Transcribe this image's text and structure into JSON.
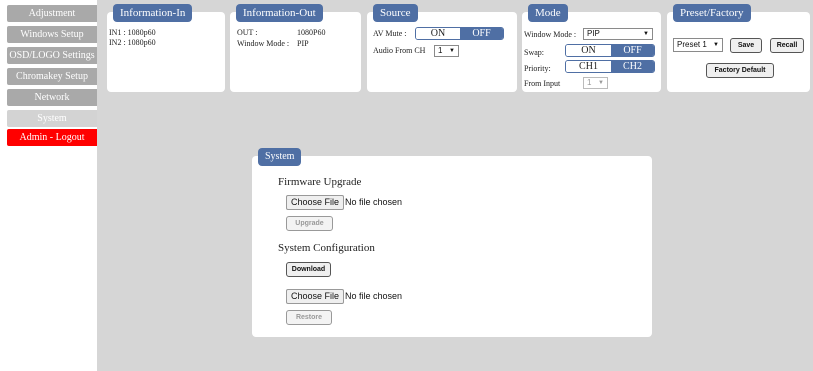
{
  "sidebar": {
    "items": [
      {
        "label": "Adjustment"
      },
      {
        "label": "Windows Setup"
      },
      {
        "label": "OSD/LOGO Settings"
      },
      {
        "label": "Chromakey Setup"
      },
      {
        "label": "Network"
      },
      {
        "label": "System"
      },
      {
        "label": "Admin - Logout"
      }
    ]
  },
  "info_in": {
    "title": "Information-In",
    "in1": "IN1 : 1080p60",
    "in2": "IN2 : 1080p60"
  },
  "info_out": {
    "title": "Information-Out",
    "out_label": "OUT :",
    "out_value": "1080P60",
    "window_mode_label": "Window Mode :",
    "window_mode_value": "PIP"
  },
  "source": {
    "title": "Source",
    "av_mute_label": "AV Mute :",
    "on": "ON",
    "off": "OFF",
    "audio_label": "Audio From CH",
    "audio_value": "1"
  },
  "mode": {
    "title": "Mode",
    "window_mode_label": "Window Mode :",
    "window_mode_value": "PIP",
    "swap_label": "Swap:",
    "swap_on": "ON",
    "swap_off": "OFF",
    "priority_label": "Priority:",
    "ch1": "CH1",
    "ch2": "CH2",
    "from_input_label": "From Input",
    "from_input_value": "1"
  },
  "preset": {
    "title": "Preset/Factory",
    "selected": "Preset 1",
    "save": "Save",
    "recall": "Recall",
    "factory_default": "Factory Default"
  },
  "system": {
    "title": "System",
    "firmware_label": "Firmware Upgrade",
    "choose_file": "Choose File",
    "no_file": "No file chosen",
    "upgrade": "Upgrade",
    "config_label": "System Configuration",
    "download": "Download",
    "choose_file2": "Choose File",
    "no_file2": "No file chosen",
    "restore": "Restore"
  },
  "colors": {
    "accent": "#4f6fa4",
    "nav_gray": "#a9a9a9",
    "logout_red": "#ff0000",
    "content_bg": "#d6d6d6"
  }
}
